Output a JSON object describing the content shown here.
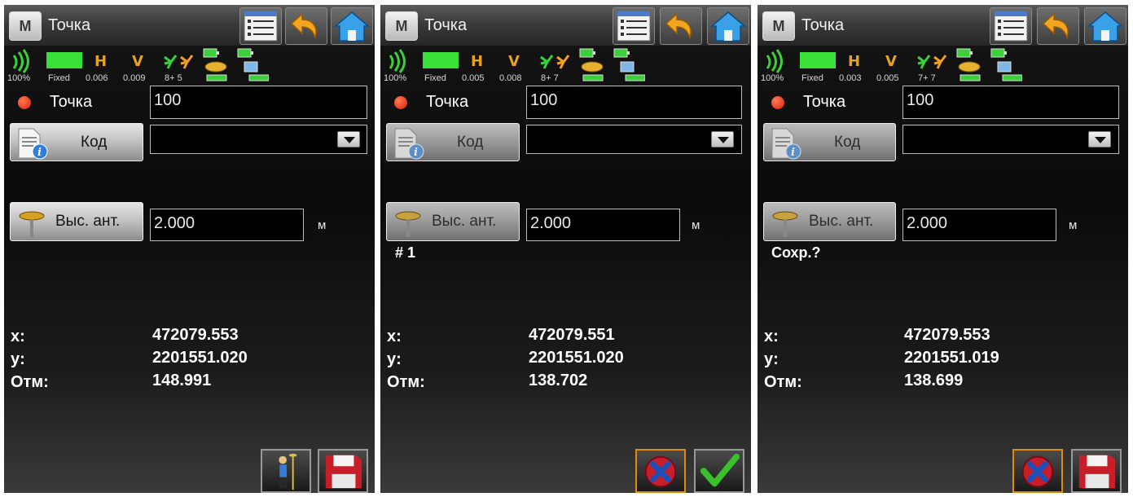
{
  "screens": [
    {
      "title": "Точка",
      "menu_label": "M",
      "status": {
        "signal": "100%",
        "solution": "Fixed",
        "h": "0.006",
        "v": "0.009",
        "sats": "8+ 5"
      },
      "point": {
        "label": "Точка",
        "value": "100"
      },
      "code": {
        "label": "Код",
        "value": ""
      },
      "antenna": {
        "label": "Выс. ант.",
        "value": "2.000",
        "unit": "м"
      },
      "message": "",
      "coords": {
        "x_label": "x:",
        "x": "472079.553",
        "y_label": "y:",
        "y": "2201551.020",
        "h_label": "Отм:",
        "h": "148.991"
      }
    },
    {
      "title": "Точка",
      "menu_label": "M",
      "status": {
        "signal": "100%",
        "solution": "Fixed",
        "h": "0.005",
        "v": "0.008",
        "sats": "8+ 7"
      },
      "point": {
        "label": "Точка",
        "value": "100"
      },
      "code": {
        "label": "Код",
        "value": ""
      },
      "antenna": {
        "label": "Выс. ант.",
        "value": "2.000",
        "unit": "м"
      },
      "message": "# 1",
      "coords": {
        "x_label": "x:",
        "x": "472079.551",
        "y_label": "y:",
        "y": "2201551.020",
        "h_label": "Отм:",
        "h": "138.702"
      }
    },
    {
      "title": "Точка",
      "menu_label": "M",
      "status": {
        "signal": "100%",
        "solution": "Fixed",
        "h": "0.003",
        "v": "0.005",
        "sats": "7+ 7"
      },
      "point": {
        "label": "Точка",
        "value": "100"
      },
      "code": {
        "label": "Код",
        "value": ""
      },
      "antenna": {
        "label": "Выс. ант.",
        "value": "2.000",
        "unit": "м"
      },
      "message": "Сохр.?",
      "coords": {
        "x_label": "x:",
        "x": "472079.553",
        "y_label": "y:",
        "y": "2201551.019",
        "h_label": "Отм:",
        "h": "138.699"
      }
    }
  ],
  "icons": {
    "menu": "menu-icon",
    "list": "list-icon",
    "back": "back-arrow-icon",
    "home": "home-icon",
    "cancel": "cancel-icon",
    "accept": "checkmark-icon",
    "save": "save-disk-icon",
    "survey": "surveyor-icon"
  },
  "colors": {
    "fix_bar": "#38e038",
    "hv_letters": "#e8a020",
    "accent_orange": "#e08a10",
    "dot_red": "#e0300a"
  }
}
